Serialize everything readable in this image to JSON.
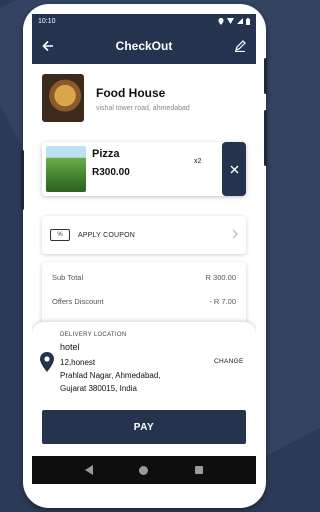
{
  "status_bar": {
    "time": "10:10"
  },
  "header": {
    "title": "CheckOut"
  },
  "restaurant": {
    "name": "Food House",
    "address": "vishal tower road, ahmedabad"
  },
  "cart_item": {
    "name": "Pizza",
    "price": "R300.00",
    "quantity": "x2"
  },
  "coupon": {
    "label": "APPLY COUPON",
    "icon_text": "%"
  },
  "summary": [
    {
      "label": "Sub Total",
      "value": "R 300.00"
    },
    {
      "label": "Offers Discount",
      "value": "- R 7.00"
    }
  ],
  "delivery": {
    "section_label": "DELIVERY LOCATION",
    "name": "hotel",
    "address_line1": "12,honest",
    "address_line2": "Prahlad Nagar, Ahmedabad,",
    "address_line3": "Gujarat 380015, India",
    "change_label": "CHANGE"
  },
  "pay_button": {
    "label": "PAY"
  },
  "colors": {
    "primary": "#26334e",
    "background": "#2b3b57"
  }
}
